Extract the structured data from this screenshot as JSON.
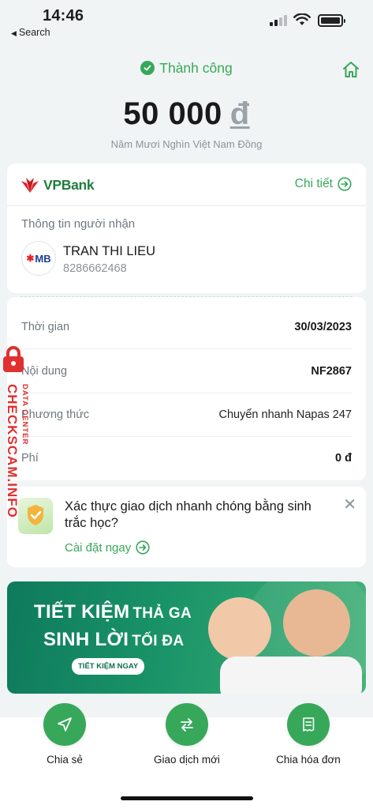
{
  "status_bar": {
    "time": "14:46",
    "back_app": "Search"
  },
  "header": {
    "status": "Thành công"
  },
  "amount": {
    "value": "50 000",
    "currency": "đ",
    "in_words": "Năm Mươi Nghìn Việt Nam Đồng"
  },
  "bank": {
    "name": "VPBank",
    "details_label": "Chi tiết"
  },
  "recipient": {
    "section_label": "Thông tin người nhận",
    "bank_logo_text": "MB",
    "name": "TRAN THI LIEU",
    "account": "8286662468"
  },
  "transaction": {
    "rows": [
      {
        "label": "Thời gian",
        "value": "30/03/2023"
      },
      {
        "label": "Nội dung",
        "value": "NF2867"
      },
      {
        "label": "Phương thức",
        "value": "Chuyển nhanh Napas 247"
      },
      {
        "label": "Phí",
        "value": "0 đ"
      }
    ]
  },
  "biometric_prompt": {
    "text": "Xác thực giao dịch nhanh chóng bằng sinh trắc học?",
    "link": "Cài đặt ngay"
  },
  "banner": {
    "line1": "TIẾT KIỆM",
    "line1_small": "THẢ GA",
    "line2": "SINH LỜI",
    "line2_small": "TỐI ĐA",
    "cta": "TIẾT KIỆM NGAY"
  },
  "actions": [
    {
      "label": "Chia sẻ",
      "icon": "send-icon"
    },
    {
      "label": "Giao dịch mới",
      "icon": "swap-icon"
    },
    {
      "label": "Chia hóa đơn",
      "icon": "bill-split-icon"
    }
  ],
  "watermark": {
    "main": "CHECKSCAM.INFO",
    "sub": "DATA CENTER"
  },
  "colors": {
    "accent": "#37a85a",
    "brand": "#1f7d3e",
    "watermark": "#e0302f"
  }
}
